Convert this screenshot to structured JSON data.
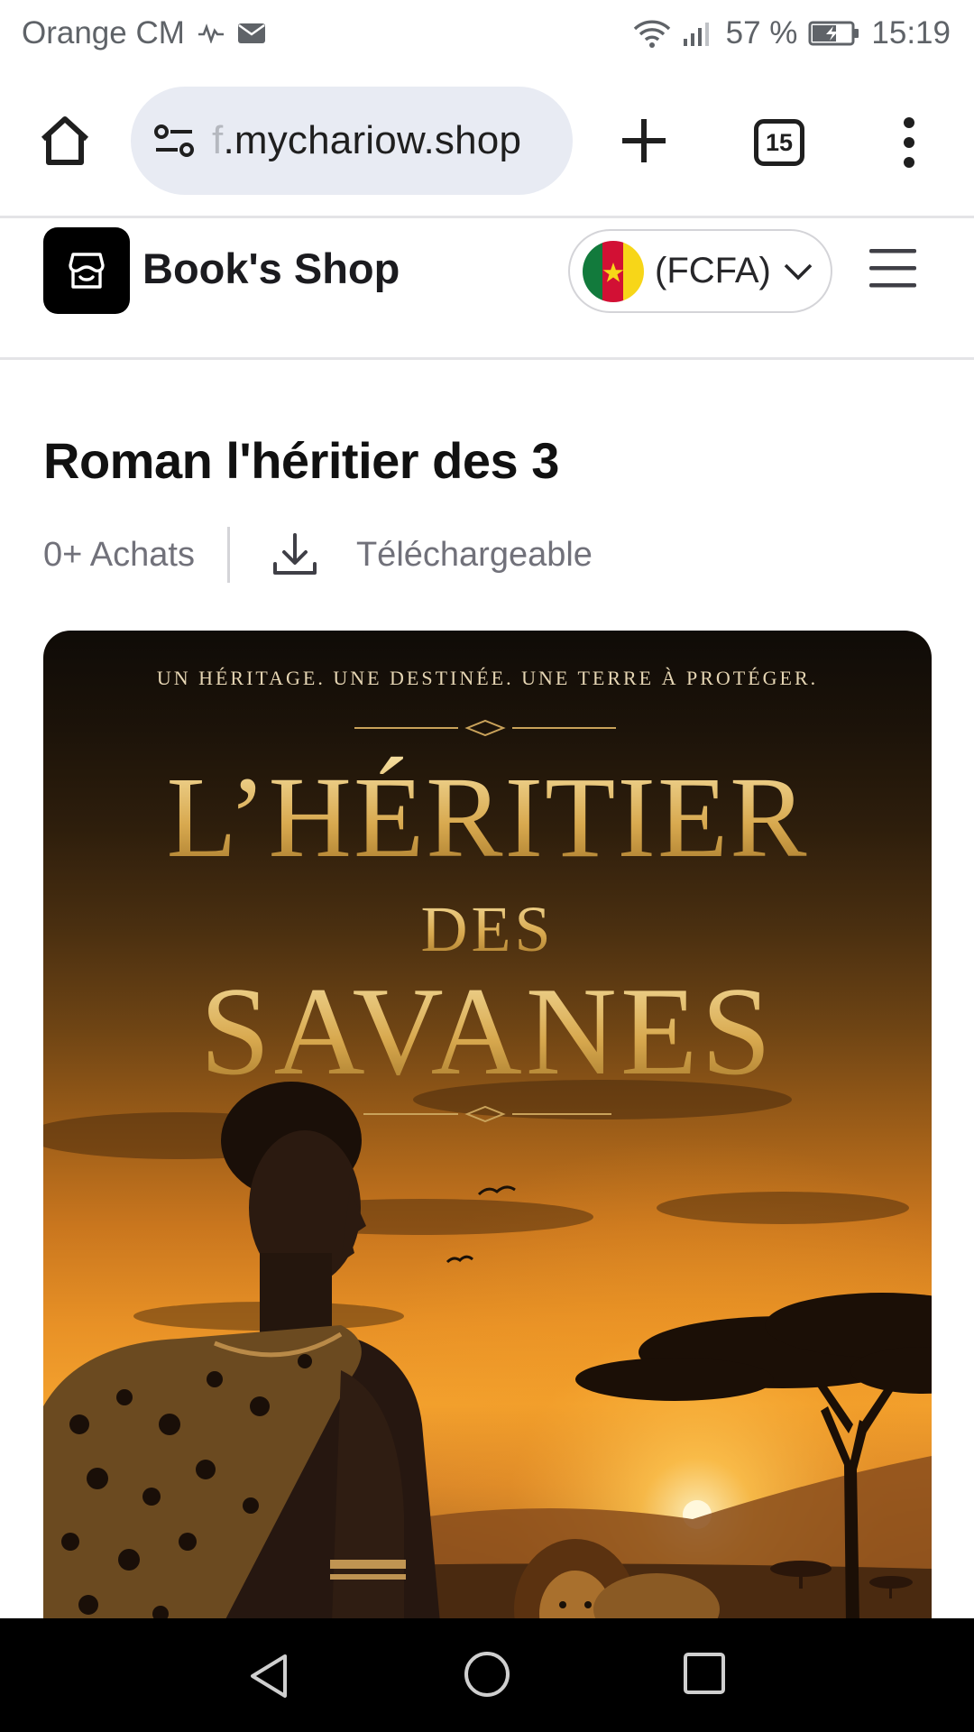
{
  "status_bar": {
    "carrier": "Orange CM",
    "battery": "57 %",
    "time": "15:19"
  },
  "browser": {
    "url_prefix": "f",
    "url": ".mychariow.shop",
    "tab_count": "15"
  },
  "shop": {
    "name": "Book's Shop",
    "currency": "(FCFA)",
    "flag": "cameroon-flag"
  },
  "product": {
    "title": "Roman l'héritier des 3",
    "purchases": "0+ Achats",
    "downloadable": "Téléchargeable"
  },
  "cover": {
    "tagline": "UN HÉRITAGE. UNE DESTINÉE. UNE TERRE À PROTÉGER.",
    "title_line_1": "L’HÉRITIER",
    "title_line_2": "DES",
    "title_line_3": "SAVANES"
  },
  "colors": {
    "accent_black": "#000000",
    "omnibox_bg": "#e8ebf3",
    "cover_gold": "#d9b05a"
  }
}
